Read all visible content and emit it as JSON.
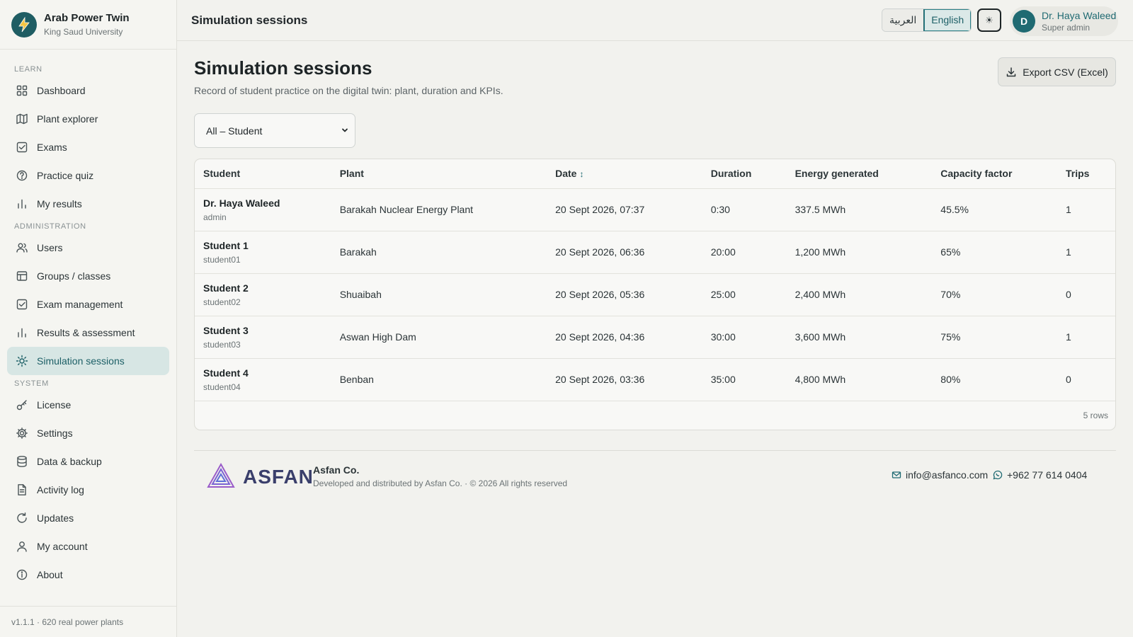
{
  "brand": {
    "name": "Arab Power Twin",
    "subtitle": "King Saud University"
  },
  "sidebar": {
    "sections": {
      "learn": "LEARN",
      "administration": "ADMINISTRATION",
      "system": "SYSTEM"
    },
    "learn_items": [
      {
        "label": "Dashboard",
        "icon": "dashboard-grid-icon"
      },
      {
        "label": "Plant explorer",
        "icon": "map-icon"
      },
      {
        "label": "Exams",
        "icon": "checkbox-icon"
      },
      {
        "label": "Practice quiz",
        "icon": "help-circle-icon"
      },
      {
        "label": "My results",
        "icon": "bar-chart-icon"
      }
    ],
    "admin_items": [
      {
        "label": "Users",
        "icon": "users-icon"
      },
      {
        "label": "Groups / classes",
        "icon": "table-icon"
      },
      {
        "label": "Exam management",
        "icon": "checkbox-icon"
      },
      {
        "label": "Results & assessment",
        "icon": "bar-chart-icon"
      },
      {
        "label": "Simulation sessions",
        "icon": "sun-icon",
        "active": true
      }
    ],
    "system_items": [
      {
        "label": "License",
        "icon": "key-icon"
      },
      {
        "label": "Settings",
        "icon": "gear-icon"
      },
      {
        "label": "Data & backup",
        "icon": "database-icon"
      },
      {
        "label": "Activity log",
        "icon": "document-icon"
      },
      {
        "label": "Updates",
        "icon": "refresh-icon"
      },
      {
        "label": "My account",
        "icon": "user-icon"
      },
      {
        "label": "About",
        "icon": "info-icon"
      }
    ],
    "footer": "v1.1.1 · 620 real power plants"
  },
  "topbar": {
    "title": "Simulation sessions",
    "lang_arabic": "العربية",
    "lang_english": "English",
    "theme_icon": "☀",
    "user": {
      "initial": "D",
      "name": "Dr. Haya Waleed",
      "role": "Super admin"
    }
  },
  "page": {
    "title": "Simulation sessions",
    "description": "Record of student practice on the digital twin: plant, duration and KPIs.",
    "export_label": "Export CSV (Excel)",
    "filter": {
      "selected": "All – Student"
    }
  },
  "table": {
    "columns": [
      "Student",
      "Plant",
      "Date",
      "Duration",
      "Energy generated",
      "Capacity factor",
      "Trips"
    ],
    "sort_column": "Date",
    "rows": [
      {
        "name": "Dr. Haya Waleed",
        "user": "admin",
        "plant": "Barakah Nuclear Energy Plant",
        "date": "20 Sept 2026, 07:37",
        "duration": "0:30",
        "energy": "337.5 MWh",
        "capacity": "45.5%",
        "trips": "1"
      },
      {
        "name": "Student 1",
        "user": "student01",
        "plant": "Barakah",
        "date": "20 Sept 2026, 06:36",
        "duration": "20:00",
        "energy": "1,200 MWh",
        "capacity": "65%",
        "trips": "1"
      },
      {
        "name": "Student 2",
        "user": "student02",
        "plant": "Shuaibah",
        "date": "20 Sept 2026, 05:36",
        "duration": "25:00",
        "energy": "2,400 MWh",
        "capacity": "70%",
        "trips": "0"
      },
      {
        "name": "Student 3",
        "user": "student03",
        "plant": "Aswan High Dam",
        "date": "20 Sept 2026, 04:36",
        "duration": "30:00",
        "energy": "3,600 MWh",
        "capacity": "75%",
        "trips": "1"
      },
      {
        "name": "Student 4",
        "user": "student04",
        "plant": "Benban",
        "date": "20 Sept 2026, 03:36",
        "duration": "35:00",
        "energy": "4,800 MWh",
        "capacity": "80%",
        "trips": "0"
      }
    ],
    "row_count": "5 rows"
  },
  "footer": {
    "logo_word": "ASFAN",
    "company": "Asfan Co.",
    "rights": "Developed and distributed by Asfan Co. · © 2026 All rights reserved",
    "email": "info@asfanco.com",
    "phone": "+962 77 614 0404"
  },
  "colors": {
    "accent": "#1f6a72",
    "active_bg": "#d7e6e4",
    "logo_purple": "#7b4fc2"
  }
}
